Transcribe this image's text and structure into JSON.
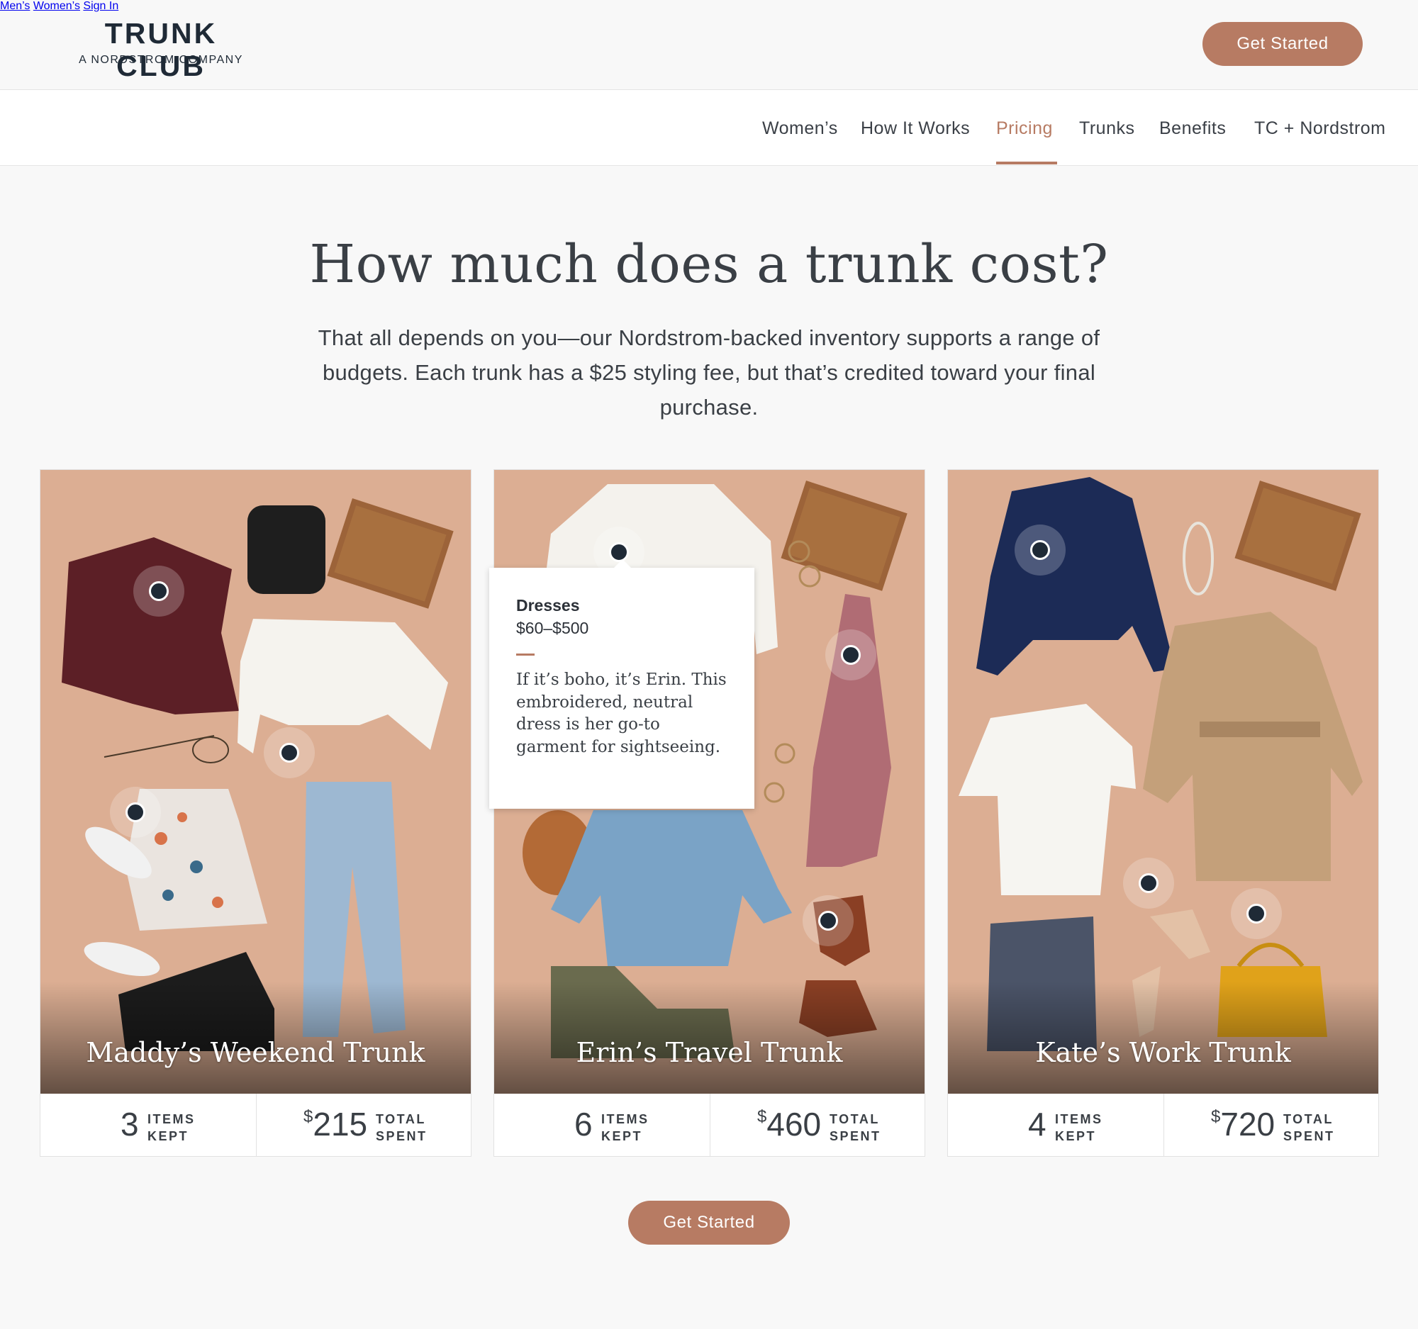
{
  "brand": {
    "name": "TRUNK CLUB",
    "tagline": "A NORDSTROM COMPANY"
  },
  "top_nav": {
    "items": [
      "Men’s",
      "Women’s",
      "Sign In"
    ],
    "cta": "Get Started"
  },
  "sub_nav": {
    "items": [
      "Women’s",
      "How It Works",
      "Pricing",
      "Trunks",
      "Benefits",
      "TC + Nordstrom"
    ],
    "active": "Pricing"
  },
  "hero": {
    "headline": "How much does a trunk cost?",
    "intro": "That all depends on you—our Nordstrom-backed inventory supports a range of budgets. Each trunk has a $25 styling fee, but that’s credited toward your final purchase."
  },
  "cards": [
    {
      "title": "Maddy’s Weekend Trunk",
      "items": "3",
      "items_label_1": "ITEMS",
      "items_label_2": "KEPT",
      "currency": "$",
      "total": "215",
      "total_label_1": "TOTAL",
      "total_label_2": "SPENT"
    },
    {
      "title": "Erin’s Travel Trunk",
      "items": "6",
      "items_label_1": "ITEMS",
      "items_label_2": "KEPT",
      "currency": "$",
      "total": "460",
      "total_label_1": "TOTAL",
      "total_label_2": "SPENT"
    },
    {
      "title": "Kate’s Work Trunk",
      "items": "4",
      "items_label_1": "ITEMS",
      "items_label_2": "KEPT",
      "currency": "$",
      "total": "720",
      "total_label_1": "TOTAL",
      "total_label_2": "SPENT"
    }
  ],
  "tooltip": {
    "title": "Dresses",
    "price": "$60–$500",
    "description": "If it’s boho, it’s Erin. This embroidered, neutral dress is her go-to garment for sightseeing."
  },
  "bottom_cta": "Get Started",
  "colors": {
    "accent": "#b77b63",
    "navy": "#1f2a36",
    "background": "#f8f8f8",
    "card_photo_bg": "#dcaf94"
  }
}
